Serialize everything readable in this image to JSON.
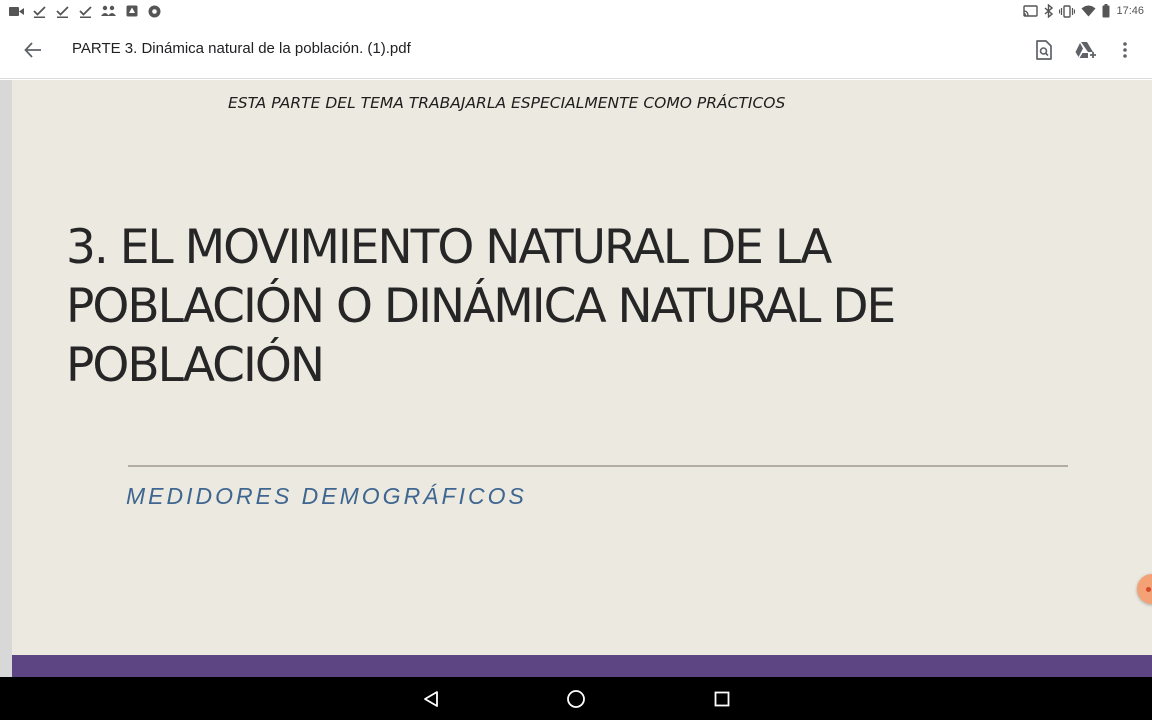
{
  "status_bar": {
    "time": "17:46",
    "left_icons": [
      "video-icon",
      "download-done-icon",
      "download-done-icon",
      "download-done-icon",
      "people-icon",
      "drive-icon",
      "chrome-icon"
    ],
    "right_icons": [
      "cast-icon",
      "bluetooth-icon",
      "vibrate-icon",
      "wifi-icon",
      "battery-icon"
    ]
  },
  "app_bar": {
    "title": "PARTE 3. Dinámica natural de la población. (1).pdf",
    "actions": [
      "search-in-document-icon",
      "add-to-drive-icon",
      "more-options-icon"
    ]
  },
  "slide": {
    "note": "ESTA PARTE DEL TEMA TRABAJARLA ESPECIALMENTE COMO PRÁCTICOS",
    "heading_lines": [
      "3. EL MOVIMIENTO NATURAL DE LA",
      "POBLACIÓN O DINÁMICA NATURAL DE",
      "POBLACIÓN"
    ],
    "subtitle": "MEDIDORES DEMOGRÁFICOS"
  },
  "colors": {
    "slide_background": "#ece9e1",
    "heading_text": "#262626",
    "subtitle_text": "#3f6690",
    "accent_band": "#5d4583",
    "rule": "#b2aca3",
    "floating_button": "#f5a176"
  },
  "nav_bar": {
    "buttons": [
      "back-triangle-icon",
      "home-circle-icon",
      "recents-square-icon"
    ]
  }
}
